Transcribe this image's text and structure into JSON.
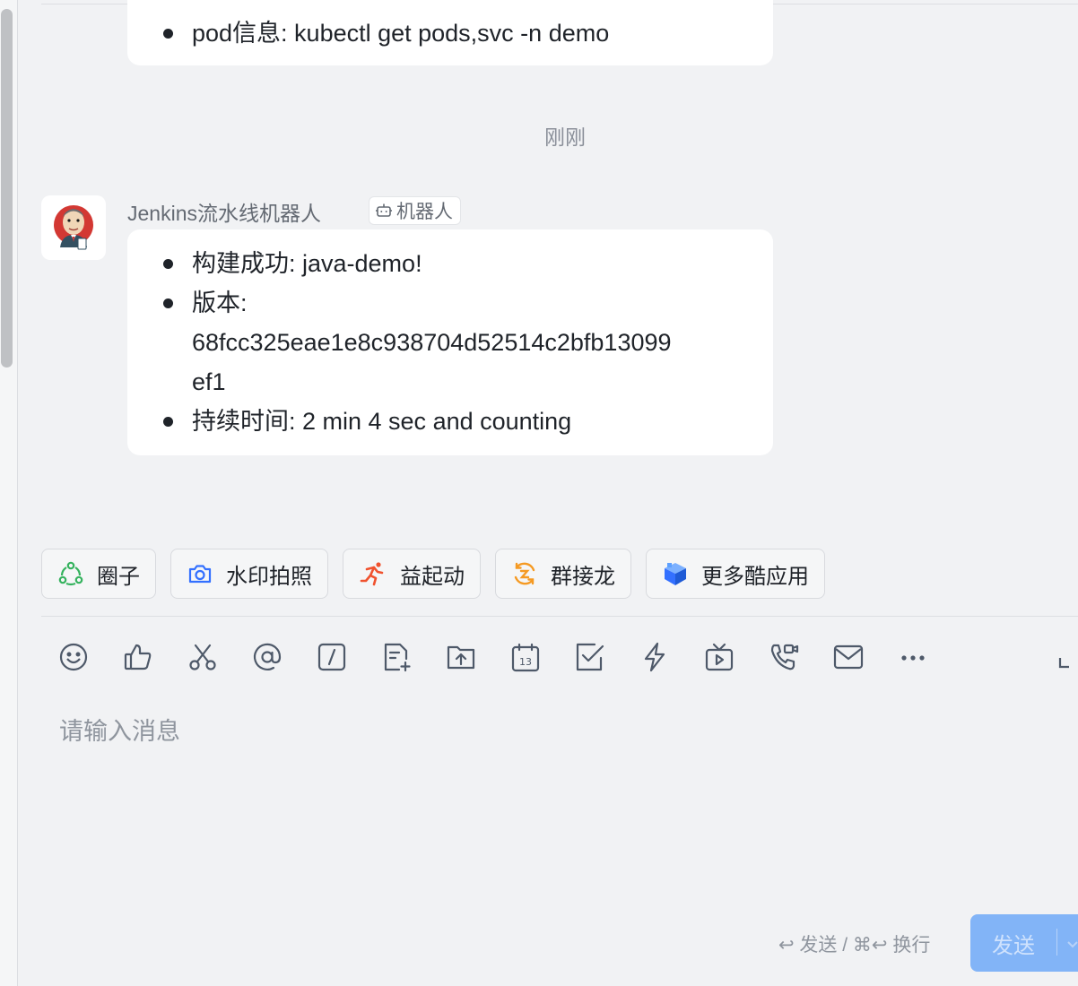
{
  "previous_message": {
    "items": [
      "pod信息: kubectl get pods,svc -n demo"
    ]
  },
  "timestamp": "刚刚",
  "message": {
    "sender": "Jenkins流水线机器人",
    "bot_tag": "机器人",
    "item1": "构建成功: java-demo!",
    "item2_label": "版本:",
    "item2_hash_line1": "68fcc325eae1e8c938704d52514c2bfb13099",
    "item2_hash_line2": "ef1",
    "item3": "持续时间: 2 min 4 sec and counting"
  },
  "apps": [
    {
      "label": "圈子",
      "icon": "circle-icon",
      "color": "#34b25d"
    },
    {
      "label": "水印拍照",
      "icon": "camera-icon",
      "color": "#3370ff"
    },
    {
      "label": "益起动",
      "icon": "runner-icon",
      "color": "#f0522e"
    },
    {
      "label": "群接龙",
      "icon": "relay-icon",
      "color": "#f59a23"
    },
    {
      "label": "更多酷应用",
      "icon": "cube-icon",
      "color": "#3370ff"
    }
  ],
  "toolbar": [
    "emoji-icon",
    "thumbs-up-icon",
    "scissors-icon",
    "at-icon",
    "slash-command-icon",
    "new-doc-icon",
    "upload-folder-icon",
    "calendar-icon",
    "task-check-icon",
    "flash-icon",
    "live-tv-icon",
    "video-call-icon",
    "mail-icon",
    "more-icon"
  ],
  "composer": {
    "placeholder": "请输入消息",
    "hint": "↩ 发送 / ⌘↩ 换行",
    "send_label": "发送"
  },
  "colors": {
    "background": "#f1f2f4",
    "bubble": "#ffffff",
    "send_button": "#82b4f7"
  }
}
